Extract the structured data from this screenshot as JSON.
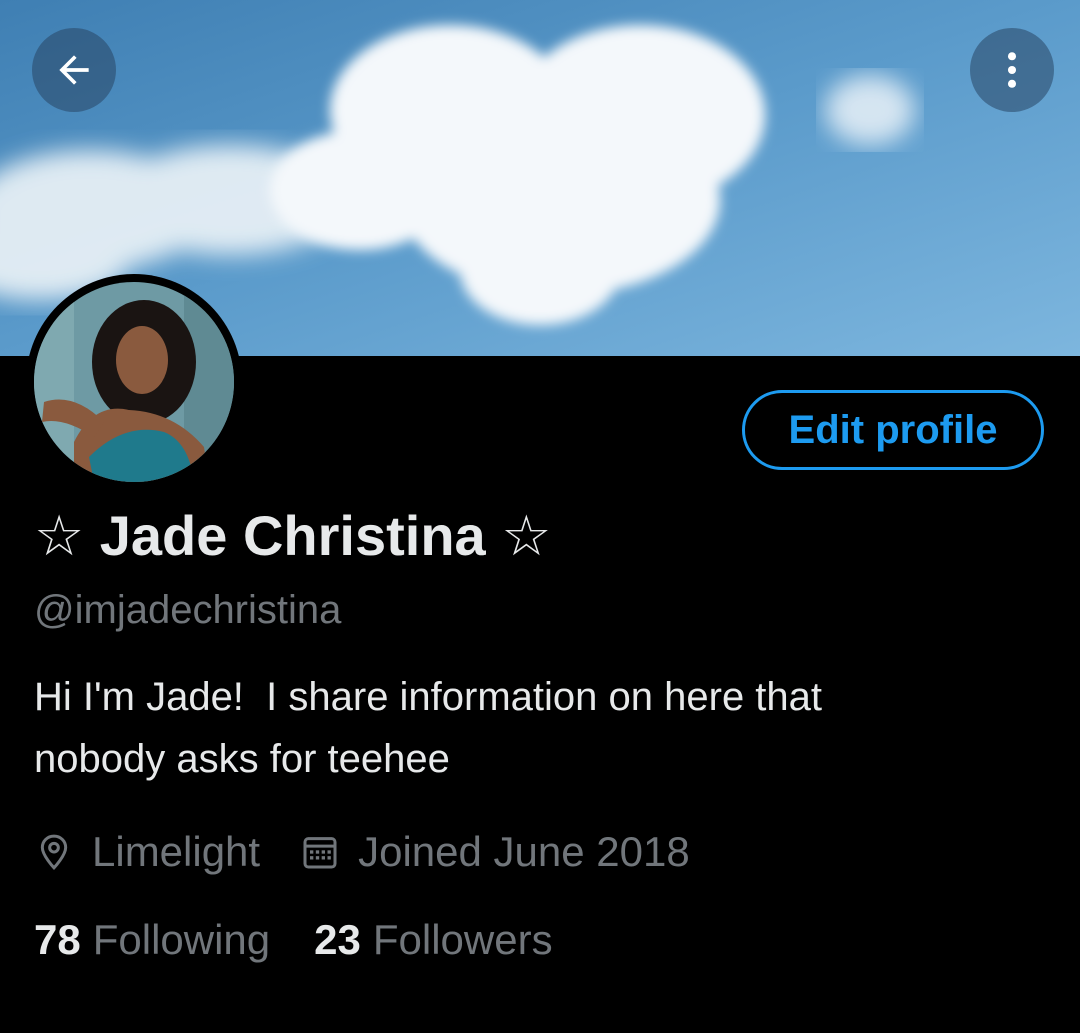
{
  "header": {
    "back_icon": "arrow-left-icon",
    "more_icon": "more-vertical-icon"
  },
  "profile": {
    "display_name": "☆ Jade Christina ☆",
    "handle": "@imjadechristina",
    "bio_line1": "Hi I'm Jade!  I share information on here that",
    "bio_line2": "nobody asks for teehee",
    "location": "Limelight",
    "joined": "Joined June 2018",
    "location_icon": "location-pin-icon",
    "calendar_icon": "calendar-icon"
  },
  "actions": {
    "edit_label": "Edit profile"
  },
  "stats": {
    "following_count": "78",
    "following_label": "Following",
    "followers_count": "23",
    "followers_label": "Followers"
  },
  "colors": {
    "accent": "#1d9bf0",
    "background": "#000000",
    "muted_text": "#71767b",
    "sky": "#5d9bc9"
  }
}
